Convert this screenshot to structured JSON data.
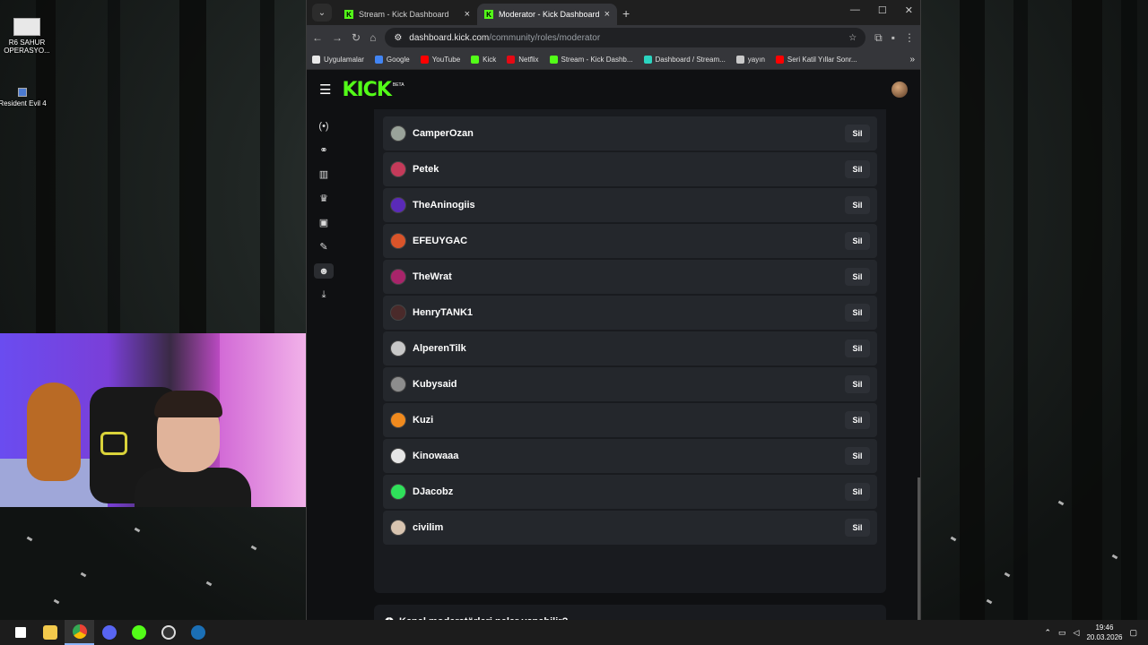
{
  "desktop": {
    "icons": [
      {
        "label": "R6 SAHUR OPERASYO..."
      },
      {
        "label": "Resident Evil 4"
      }
    ]
  },
  "browser": {
    "tabs": [
      {
        "title": "Stream - Kick Dashboard",
        "active": false
      },
      {
        "title": "Moderator - Kick Dashboard",
        "active": true
      }
    ],
    "new_tab": "+",
    "window_controls": {
      "minimize": "—",
      "maximize": "☐",
      "close": "✕"
    },
    "url": {
      "domain": "dashboard.kick.com",
      "path": "/community/roles/moderator"
    },
    "bookmarks": [
      {
        "label": "Uygulamalar",
        "color": "#e8e8e8"
      },
      {
        "label": "Google",
        "color": "#4285f4"
      },
      {
        "label": "YouTube",
        "color": "#ff0000"
      },
      {
        "label": "Kick",
        "color": "#53fc18"
      },
      {
        "label": "Netflix",
        "color": "#e50914"
      },
      {
        "label": "Stream - Kick Dashb...",
        "color": "#53fc18"
      },
      {
        "label": "Dashboard / Stream...",
        "color": "#2bd4c0"
      },
      {
        "label": "yayın",
        "color": "#c9c9c9"
      },
      {
        "label": "Seri Katil Yıllar Sonr...",
        "color": "#ff0000"
      }
    ],
    "bookmarks_more": "»"
  },
  "kick": {
    "logo": "KICK",
    "beta": "BETA",
    "accent": "#53fc18",
    "sidebar_icons": [
      "broadcast-icon",
      "link-icon",
      "analytics-icon",
      "trophy-icon",
      "media-icon",
      "wrench-icon",
      "community-icon",
      "download-icon"
    ],
    "active_sidebar": "community-icon",
    "moderators": [
      {
        "name": "CamperOzan",
        "avatar_color": "#9aa39a"
      },
      {
        "name": "Petek",
        "avatar_color": "#c43a5a"
      },
      {
        "name": "TheAninogiis",
        "avatar_color": "#5a2ab8"
      },
      {
        "name": "EFEUYGAC",
        "avatar_color": "#d9542a"
      },
      {
        "name": "TheWrat",
        "avatar_color": "#a8246a"
      },
      {
        "name": "HenryTANK1",
        "avatar_color": "#4a2a2a"
      },
      {
        "name": "AlperenTilk",
        "avatar_color": "#c8c8c8"
      },
      {
        "name": "Kubysaid",
        "avatar_color": "#8d8d8d"
      },
      {
        "name": "Kuzi",
        "avatar_color": "#f08a1e"
      },
      {
        "name": "Kinowaaa",
        "avatar_color": "#e6e6e6"
      },
      {
        "name": "DJacobz",
        "avatar_color": "#2fe05a"
      },
      {
        "name": "civilim",
        "avatar_color": "#d8c4b0"
      }
    ],
    "remove_label": "Sil",
    "faq_label": "Kanal moderatörleri neler yapabilir?",
    "faq_icon": "info-icon",
    "support_icon": "headset-icon"
  },
  "taskbar": {
    "time": "19:46",
    "date": "20.03.2026"
  }
}
